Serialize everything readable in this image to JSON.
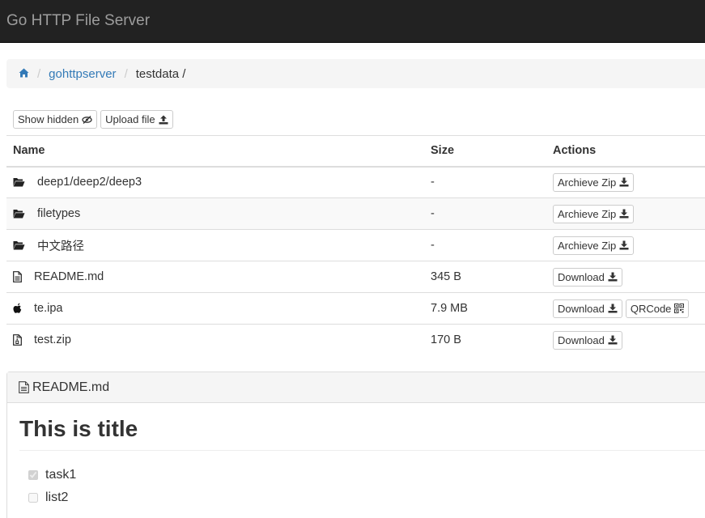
{
  "navbar": {
    "brand": "Go HTTP File Server"
  },
  "breadcrumb": {
    "home_icon": "home-icon",
    "items": [
      {
        "label": "gohttpserver"
      },
      {
        "label": "testdata /"
      }
    ]
  },
  "toolbar": {
    "show_hidden_label": "Show hidden",
    "show_hidden_icon": "eye-slash-icon",
    "upload_label": "Upload file",
    "upload_icon": "upload-icon"
  },
  "table": {
    "headers": {
      "name": "Name",
      "size": "Size",
      "actions": "Actions"
    },
    "rows": [
      {
        "icon": "folder-icon",
        "name": "deep1/deep2/deep3",
        "size": "-",
        "actions": [
          "Archieve Zip"
        ]
      },
      {
        "icon": "folder-icon",
        "name": "filetypes",
        "size": "-",
        "actions": [
          "Archieve Zip"
        ]
      },
      {
        "icon": "folder-icon",
        "name": "中文路径",
        "size": "-",
        "actions": [
          "Archieve Zip"
        ]
      },
      {
        "icon": "file-text-icon",
        "name": "README.md",
        "size": "345 B",
        "actions": [
          "Download"
        ]
      },
      {
        "icon": "apple-icon",
        "name": "te.ipa",
        "size": "7.9 MB",
        "actions": [
          "Download",
          "QRCode"
        ]
      },
      {
        "icon": "file-zip-icon",
        "name": "test.zip",
        "size": "170 B",
        "actions": [
          "Download"
        ]
      }
    ]
  },
  "readme": {
    "title": "README.md",
    "heading": "This is title",
    "tasks": [
      {
        "label": "task1",
        "checked": true
      },
      {
        "label": "list2",
        "checked": false
      }
    ]
  }
}
